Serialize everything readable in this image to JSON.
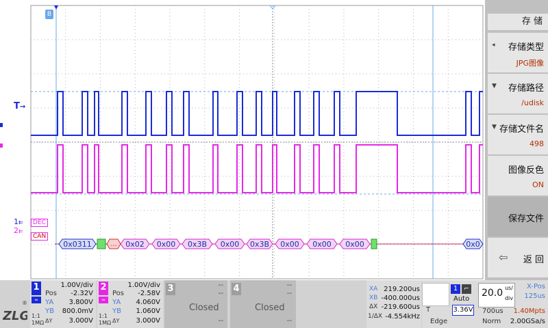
{
  "waveform": {
    "trigger_label": "T",
    "ch1_label": "1",
    "ch2_label": "2",
    "dec_label": "DEC",
    "can_label": "CAN",
    "top_marker": "B",
    "can_frames": [
      "0x0311",
      "0x02",
      "0x00",
      "0x3B",
      "0x00",
      "0x3B",
      "0x00",
      "0x00",
      "0x00",
      "0x0"
    ],
    "can_dots": "...",
    "colors": {
      "ch1": "#1a2bd6",
      "ch2": "#e628e6",
      "cursor": "#6aa8e8",
      "decode": "#8090e0"
    }
  },
  "menu": {
    "title": "存 储",
    "items": [
      {
        "label": "存储类型",
        "value": "JPG图像"
      },
      {
        "label": "存储路径",
        "value": "/udisk"
      },
      {
        "label": "存储文件名",
        "value": "498"
      },
      {
        "label": "图像反色",
        "value": "ON"
      },
      {
        "label": "保存文件",
        "value": ""
      },
      {
        "label": "返 回",
        "value": ""
      }
    ]
  },
  "status": {
    "ch1": {
      "num": "1",
      "scale": "1.00V/div",
      "pos_label": "Pos",
      "pos": "-2.32V",
      "ya_label": "YA",
      "ya": "3.800V",
      "yb_label": "YB",
      "yb": "800.0mV",
      "dy": "3.000V",
      "coupling": "1:1",
      "imp": "1MΩ"
    },
    "ch2": {
      "num": "2",
      "scale": "1.00V/div",
      "pos_label": "Pos",
      "pos": "-2.58V",
      "ya_label": "YA",
      "ya": "4.060V",
      "yb_label": "YB",
      "yb": "1.060V",
      "dy": "3.000V",
      "coupling": "1:1",
      "imp": "1MΩ"
    },
    "ch3": {
      "num": "3",
      "text": "Closed",
      "dashes": "--"
    },
    "ch4": {
      "num": "4",
      "text": "Closed",
      "dashes": "--"
    },
    "cursor": {
      "xa_label": "XA",
      "xa": "219.200us",
      "xb_label": "XB",
      "xb": "-400.000us",
      "dx_label": "ΔX",
      "dx": "-219.600us",
      "inv_label": "1/ΔX",
      "inv": "-4.554kHz"
    },
    "trigger": {
      "mode": "Auto",
      "level": "3.36V",
      "type": "Edge",
      "source": "1",
      "timebase": "20.0",
      "unit_top": "us/",
      "unit_bottom": "div",
      "xpos_label": "X-Pos",
      "xpos": "125us",
      "rate": "700us",
      "mpts": "1.40Mpts",
      "norm": "Norm",
      "gsa": "2.00GSa/s",
      "label": "T"
    }
  }
}
